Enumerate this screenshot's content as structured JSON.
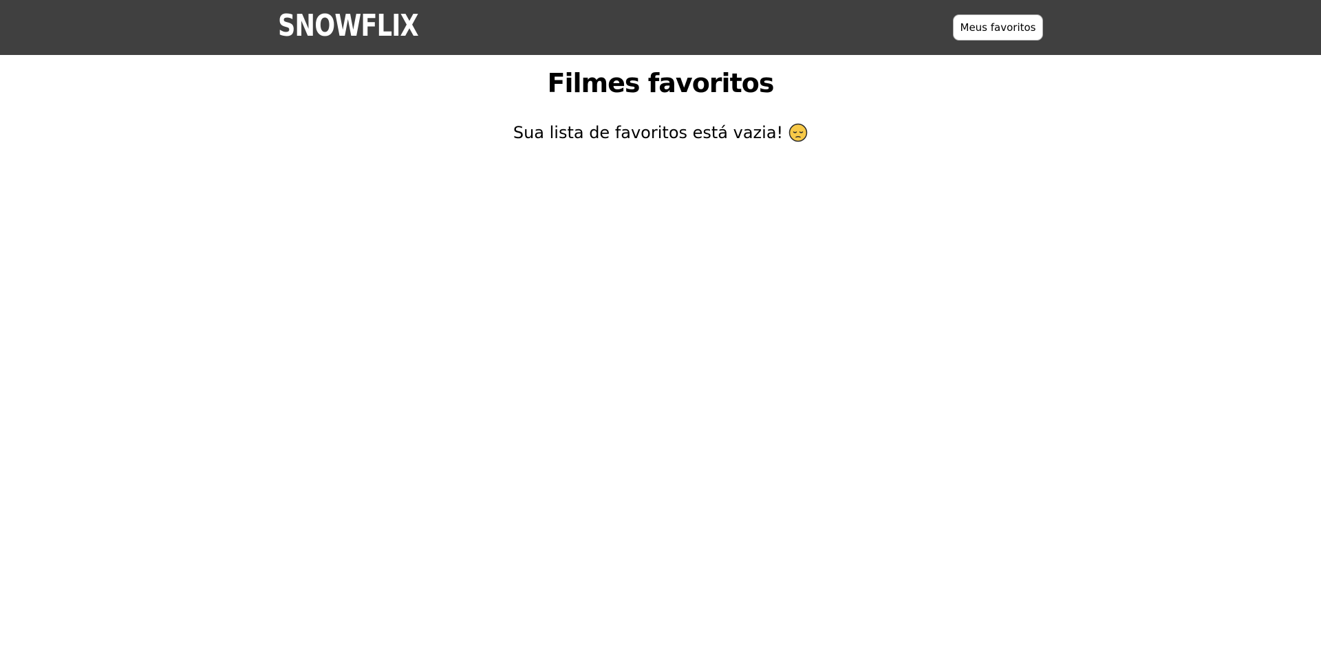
{
  "header": {
    "brand": "SNOWFLIX",
    "favorites_button": "Meus favoritos",
    "background_color": "#404040"
  },
  "main": {
    "title": "Filmes favoritos",
    "empty_message": "Sua lista de favoritos está vazia!",
    "empty_icon": "pensive-face-icon"
  }
}
